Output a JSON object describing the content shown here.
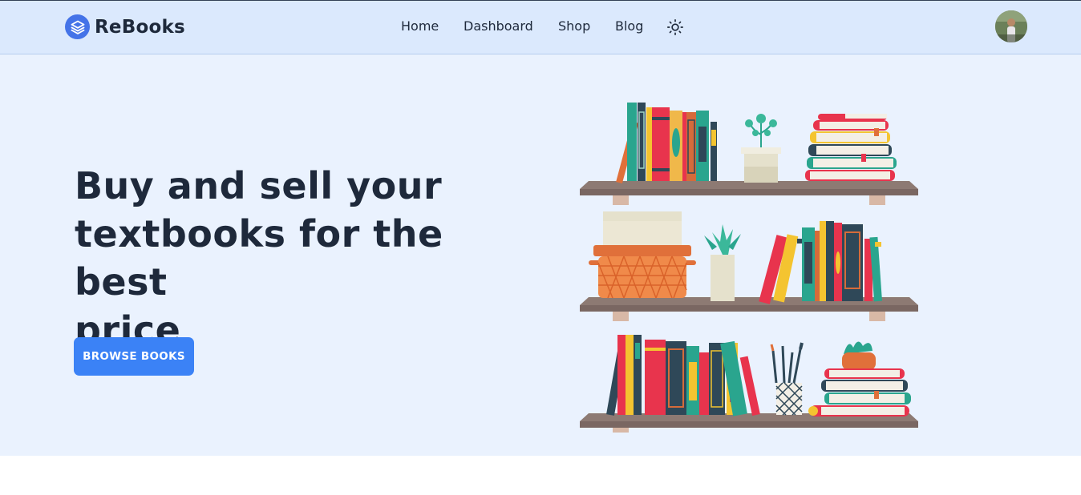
{
  "brand": {
    "name": "ReBooks",
    "logo_icon": "layers-icon",
    "accent": "#4473e8"
  },
  "nav": {
    "items": [
      {
        "label": "Home"
      },
      {
        "label": "Dashboard"
      },
      {
        "label": "Shop"
      },
      {
        "label": "Blog"
      }
    ],
    "theme_toggle_icon": "sun-icon",
    "avatar_icon": "user-avatar"
  },
  "hero": {
    "title_lines": [
      "Buy and sell your",
      "textbooks for the best",
      "price"
    ],
    "cta_label": "BROWSE BOOKS",
    "cta_color": "#3b82f6",
    "illustration": "bookshelves-illustration"
  },
  "colors": {
    "navbar_bg": "#dbe9fd",
    "hero_bg": "#eaf2fe",
    "text": "#1e293b"
  }
}
